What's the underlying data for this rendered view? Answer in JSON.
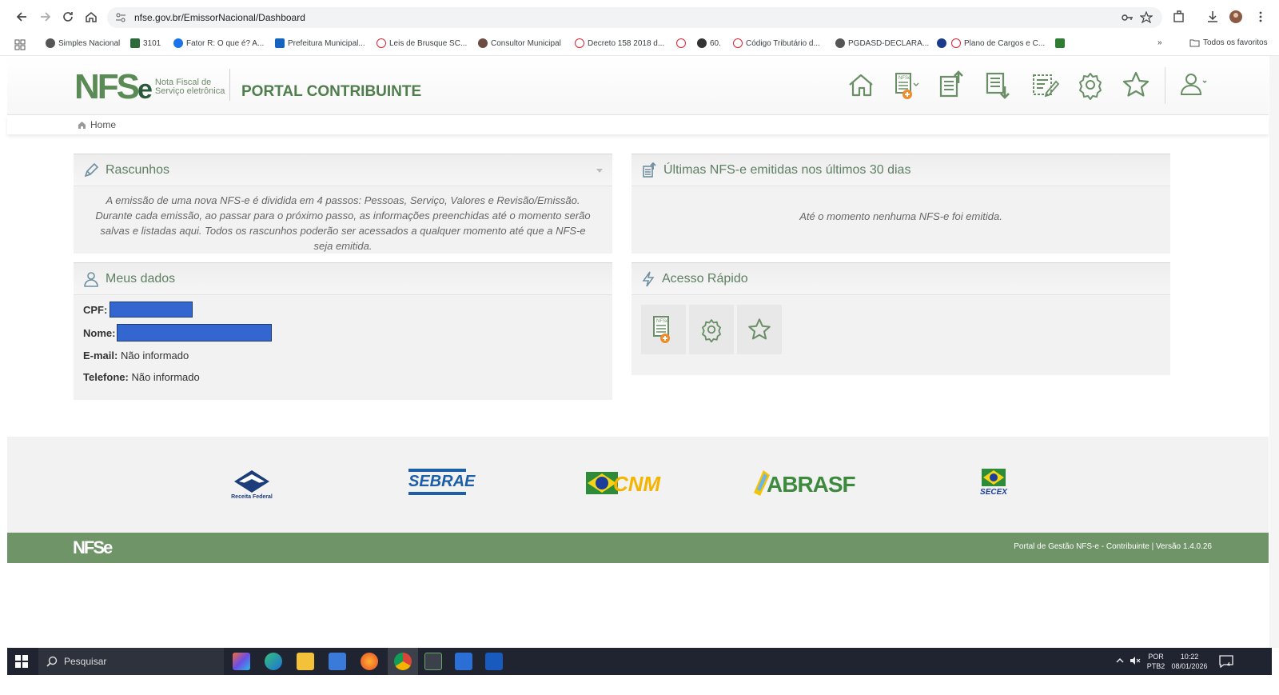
{
  "browser": {
    "url": "nfse.gov.br/EmissorNacional/Dashboard",
    "bookmarks": [
      "Simples Nacional",
      "3101",
      "Fator R: O que é? A...",
      "Prefeitura Municipal...",
      "Leis de Brusque SC...",
      "Consultor Municipal",
      "Decreto 158 2018 d...",
      "60.",
      "Código Tributário d...",
      "PGDASD-DECLARA...",
      "Plano de Cargos e C..."
    ],
    "all_bookmarks_label": "Todos os favoritos"
  },
  "header": {
    "logo_text": "NFS",
    "logo_e": "e",
    "logo_sub_line1": "Nota Fiscal de",
    "logo_sub_line2": "Serviço eletrônica",
    "title": "PORTAL CONTRIBUINTE",
    "icons": [
      "home-icon",
      "new-invoice-icon",
      "issued-invoices-icon",
      "received-invoices-icon",
      "edit-invoice-icon",
      "settings-icon",
      "favorites-icon",
      "user-icon"
    ]
  },
  "breadcrumb": {
    "home": "Home"
  },
  "rascunhos": {
    "title": "Rascunhos",
    "text": "A emissão de uma nova NFS-e é dividida em 4 passos: Pessoas, Serviço, Valores e Revisão/Emissão. Durante cada emissão, ao passar para o próximo passo, as informações preenchidas até o momento serão salvas e listadas aqui. Todos os rascunhos poderão ser acessados a qualquer momento até que a NFS-e seja emitida."
  },
  "ultimas": {
    "title": "Últimas NFS-e emitidas nos últimos 30 dias",
    "empty": "Até o momento nenhuma NFS-e foi emitida."
  },
  "meus_dados": {
    "title": "Meus dados",
    "cpf_label": "CPF:",
    "nome_label": "Nome:",
    "email_label": "E-mail:",
    "email_value": "Não informado",
    "telefone_label": "Telefone:",
    "telefone_value": "Não informado"
  },
  "acesso_rapido": {
    "title": "Acesso Rápido",
    "buttons": [
      "new-invoice-icon",
      "settings-icon",
      "favorites-icon"
    ]
  },
  "footer": {
    "logos": [
      "Receita Federal",
      "SEBRAE",
      "CNM",
      "ABRASF",
      "SECEX"
    ],
    "brand": "NFSe",
    "version": "Portal de Gestão NFS-e - Contribuinte | Versão 1.4.0.26"
  },
  "taskbar": {
    "search_placeholder": "Pesquisar",
    "lang_line1": "POR",
    "lang_line2": "PTB2",
    "time": "10:22",
    "date": "08/01/2026"
  },
  "colors": {
    "brand_green": "#5a8a55",
    "footer_green": "#6f9468",
    "redaction_blue": "#3466cf"
  }
}
